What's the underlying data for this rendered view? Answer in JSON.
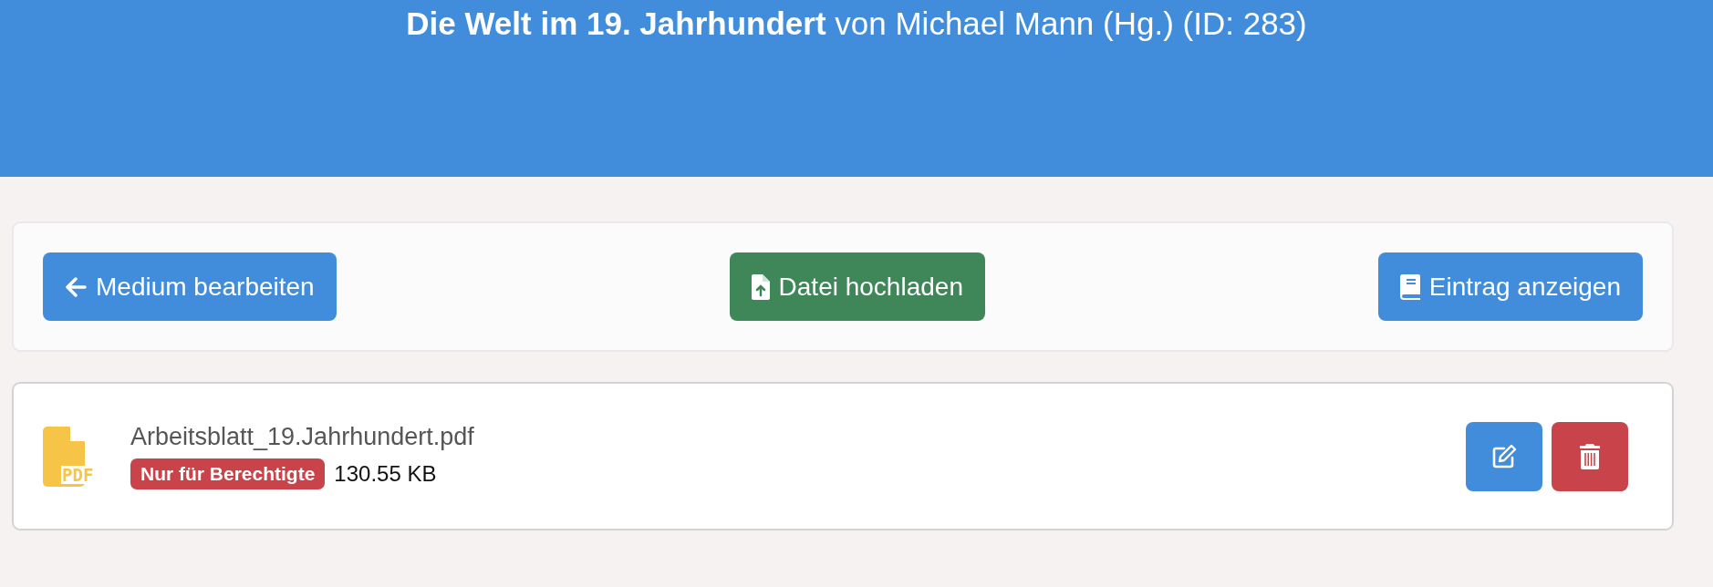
{
  "header": {
    "title": "**Die Welt im 19. Jahrhundert** von Michael Mann (Hg.) (ID: 283)"
  },
  "toolbar": {
    "buttons": [
      {
        "label": "Medium bearbeiten",
        "kind": "back"
      },
      {
        "label": "Datei hochladen",
        "kind": "upload"
      },
      {
        "label": "Eintrag anzeigen",
        "kind": "view"
      }
    ]
  },
  "files": [
    {
      "type_label": "PDF",
      "name": "Arbeitsblatt_19.Jahrhundert.pdf",
      "badge": "Nur für Berechtigte",
      "size": "130.55 KB",
      "actions": [
        {
          "kind": "edit"
        },
        {
          "kind": "delete"
        }
      ]
    }
  ]
}
